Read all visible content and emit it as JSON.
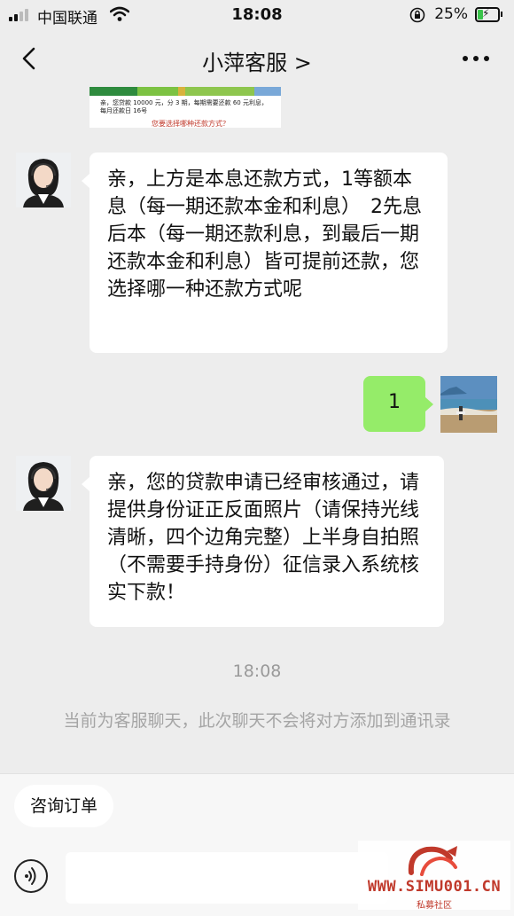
{
  "status_bar": {
    "carrier": "中国联通",
    "time": "18:08",
    "battery_percent": "25%",
    "signal_bars": 2,
    "battery_level": 0.25,
    "charging": true
  },
  "nav": {
    "title": "小萍客服 >",
    "back_icon": "chevron-left-icon",
    "more_icon": "more-dots-icon"
  },
  "image_snippet": {
    "text_line1": "亲，您贷款 10000 元，分 3 期，每期需要还款 60 元利息，",
    "text_line2": "每月还款日 16号",
    "question": "您要选择哪种还款方式？"
  },
  "messages": [
    {
      "side": "left",
      "sender": "客服",
      "text": "亲，上方是本息还款方式，1等额本息（每一期还款本金和利息）　2先息后本（每一期还款利息，到最后一期还款本金和利息）皆可提前还款，您选择哪一种还款方式呢"
    },
    {
      "side": "right",
      "sender": "me",
      "text": "1"
    },
    {
      "side": "left",
      "sender": "客服",
      "text": "亲，您的贷款申请已经审核通过，请提供身份证正反面照片（请保持光线清晰，四个边角完整）上半身自拍照（不需要手持身份）征信录入系统核实下款！"
    }
  ],
  "timestamp": "18:08",
  "notice": "当前为客服聊天，此次聊天不会将对方添加到通讯录",
  "bottom": {
    "quick_reply": "咨询订单",
    "input_value": "",
    "voice_icon": "voice-icon"
  },
  "watermark": {
    "text": "WWW.SIMU001.CN",
    "sub": "私募社区"
  },
  "colors": {
    "background": "#ededed",
    "bubble_left": "#ffffff",
    "bubble_right": "#95ec69",
    "timestamp": "#9a9a9a",
    "watermark": "#c0392b"
  }
}
